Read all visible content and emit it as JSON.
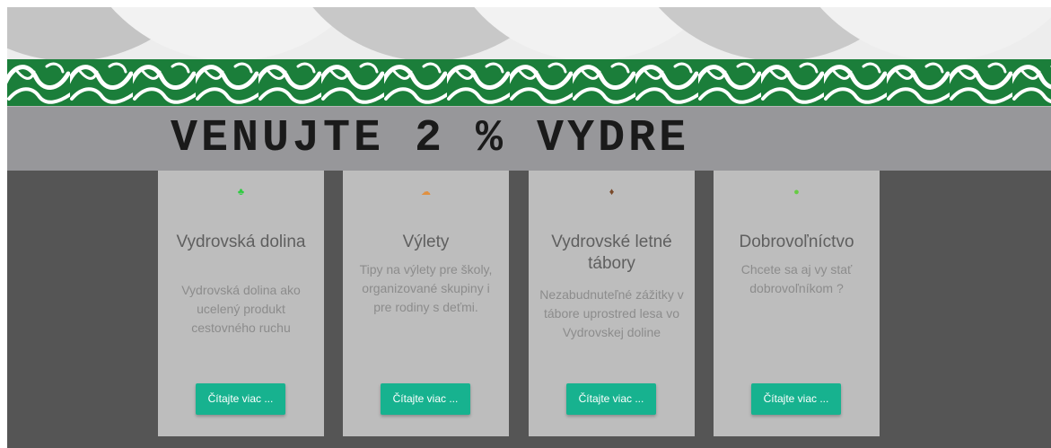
{
  "banner": {
    "title": "VENUJTE 2 % VYDRE"
  },
  "cards": [
    {
      "icon": "tree-icon",
      "icon_color": "#2ecc40",
      "glyph": "♣",
      "title": "Vydrovská dolina",
      "text": "Vydrovská dolina ako ucelený produkt cestovného ruchu",
      "button": "Čítajte viac ..."
    },
    {
      "icon": "shoes-icon",
      "icon_color": "#e09040",
      "glyph": "☁",
      "title": "Výlety",
      "text": "Tipy na výlety pre školy, organizované skupiny i pre rodiny s deťmi.",
      "button": "Čítajte viac ..."
    },
    {
      "icon": "campfire-icon",
      "icon_color": "#7a4a2a",
      "glyph": "♦",
      "title": "Vydrovské letné tábory",
      "text": "Nezabudnuteľné zážitky v tábore uprostred lesa vo Vydrovskej doline",
      "button": "Čítajte viac ..."
    },
    {
      "icon": "circle-icon",
      "icon_color": "#66cc44",
      "glyph": "●",
      "title": "Dobrovoľníctvo",
      "text": "Chcete sa aj vy stať dobrovoľníkom ?",
      "button": "Čítajte viac ..."
    }
  ]
}
